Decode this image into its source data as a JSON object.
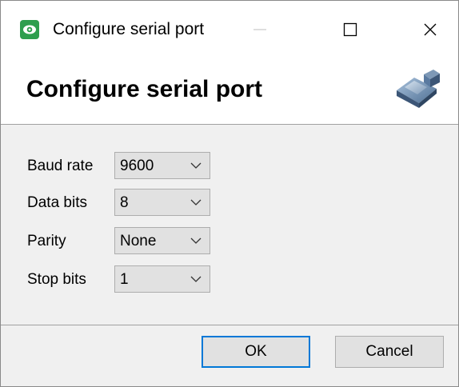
{
  "window": {
    "title": "Configure serial port",
    "title_icon": "eye-icon",
    "controls": [
      "minimize-icon",
      "maximize-icon",
      "close-icon"
    ]
  },
  "header": {
    "title": "Configure serial port",
    "icon": "serial-connector-icon"
  },
  "form": {
    "fields": [
      {
        "label": "Baud rate",
        "value": "9600"
      },
      {
        "label": "Data bits",
        "value": "8"
      },
      {
        "label": "Parity",
        "value": "None"
      },
      {
        "label": "Stop bits",
        "value": "1"
      }
    ]
  },
  "buttons": {
    "ok_label": "OK",
    "cancel_label": "Cancel"
  },
  "colors": {
    "accent": "#0078d7",
    "app_icon": "#2e9e4e",
    "window_bg": "#f0f0f0",
    "header_bg": "#ffffff"
  }
}
